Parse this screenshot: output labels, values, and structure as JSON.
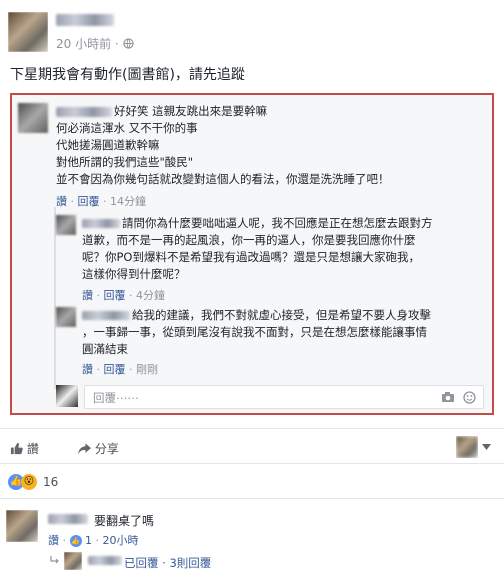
{
  "post": {
    "time": "20 小時前 ·",
    "privacy_icon": "globe-icon",
    "text": "下星期我會有動作(圖書館)，請先追蹤"
  },
  "screenshot": {
    "comments": [
      {
        "lines": [
          "好好笑 這親友跳出來是要幹嘛",
          "何必淌這渾水 又不干你的事",
          "代她搓湯圓道歉幹嘛",
          "對他所謂的我們這些\"酸民\"",
          "並不會因為你幾句話就改變對這個人的看法，你還是洗洗睡了吧！"
        ],
        "like": "讚",
        "reply": "回覆",
        "time": "14分鐘"
      },
      {
        "lines": [
          "請問你為什麼要咄咄逼人呢，我不回應是正在想怎麼去跟對方",
          "道歉，而不是一再的起風浪，你一再的逼人，你是要我回應你什麼",
          "呢？你PO到爆料不是希望我有過改過嗎？還是只是想讓大家砲我，",
          "這樣你得到什麼呢？"
        ],
        "like": "讚",
        "reply": "回覆",
        "time": "4分鐘"
      },
      {
        "lines": [
          "給我的建議，我們不對就虛心接受，但是希望不要人身攻擊",
          "，一事歸一事，從頭到尾沒有說我不面對，只是在想怎麼樣能讓事情",
          "圓滿結束"
        ],
        "like": "讚",
        "reply": "回覆",
        "time": "剛剛"
      }
    ],
    "reply_placeholder": "回覆⋯⋯"
  },
  "actions": {
    "like": "讚",
    "share": "分享"
  },
  "reactions": {
    "count": "16"
  },
  "comment": {
    "text": "要翻桌了嗎",
    "like": "讚",
    "like_count": "1",
    "time": "20小時",
    "reply_summary_a": "已回覆 ·",
    "reply_summary_b": "3則回覆"
  }
}
